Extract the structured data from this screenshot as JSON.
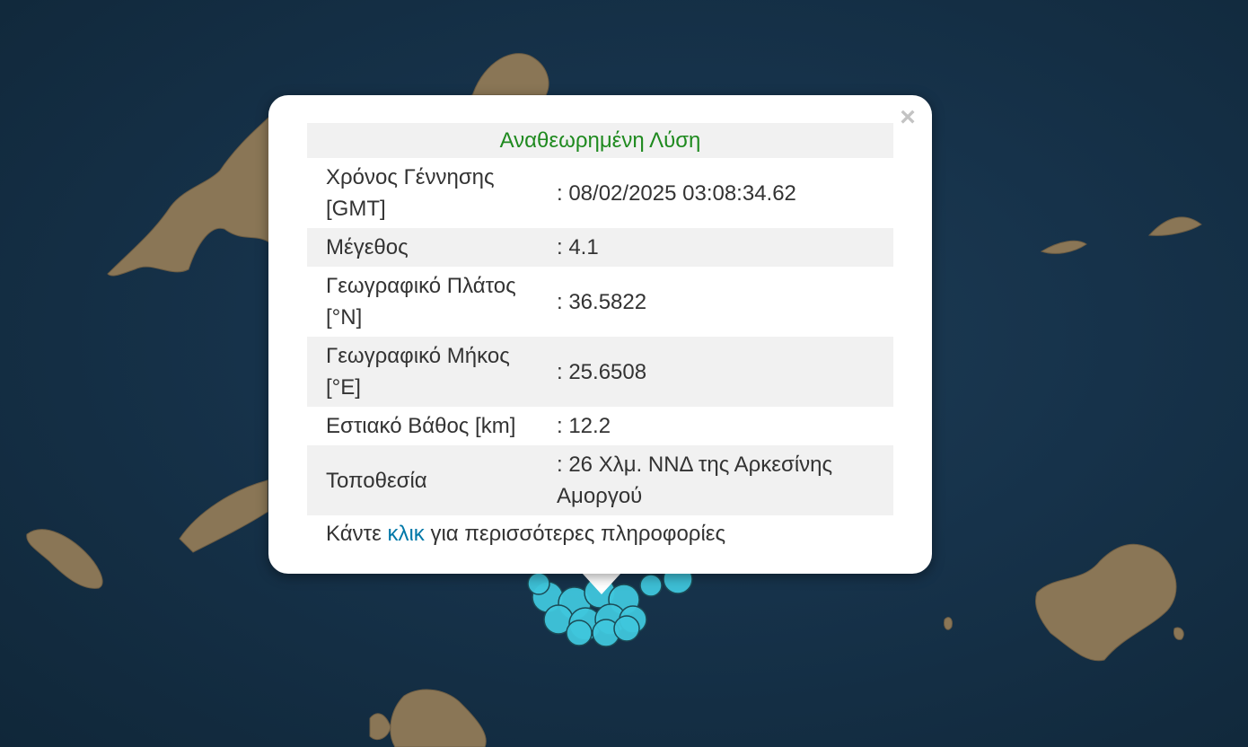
{
  "popup": {
    "title": "Αναθεωρημένη Λύση",
    "close_symbol": "×",
    "rows": [
      {
        "label": "Χρόνος Γέννησης [GMT]",
        "value": ": 08/02/2025 03:08:34.62"
      },
      {
        "label": "Μέγεθος",
        "value": ": 4.1"
      },
      {
        "label": "Γεωγραφικό Πλάτος [°N]",
        "value": ": 36.5822"
      },
      {
        "label": "Γεωγραφικό Μήκος [°E]",
        "value": ": 25.6508"
      },
      {
        "label": "Εστιακό Βάθος [km]",
        "value": ": 12.2"
      },
      {
        "label": "Τοποθεσία",
        "value": ": 26 Χλμ. ΝΝΔ της Αρκεσίνης Αμοργού"
      }
    ],
    "more_prefix": "Κάντε",
    "more_link": "κλικ",
    "more_suffix": "για περισσότερες πληροφορίες"
  },
  "map": {
    "sea_color": "#16324a",
    "land_color": "#8a7656",
    "marker_fill": "#3fc6dc",
    "marker_stroke": "#1b4a55"
  }
}
